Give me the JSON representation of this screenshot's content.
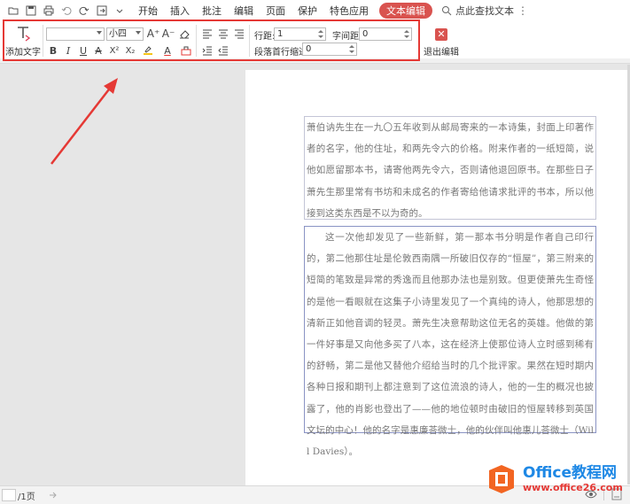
{
  "menu": {
    "items": [
      "开始",
      "插入",
      "批注",
      "编辑",
      "页面",
      "保护",
      "特色应用"
    ],
    "active": "文本编辑",
    "search": "点此查找文本"
  },
  "ribbon": {
    "add_text": "添加文字",
    "font_name": "",
    "font_size": "小四",
    "line_spacing_label": "行距:",
    "line_spacing_value": "1",
    "char_spacing_label": "字间距:",
    "char_spacing_value": "0",
    "indent_label": "段落首行缩进:",
    "indent_value": "0",
    "exit_edit": "退出编辑",
    "bold": "B",
    "italic": "I",
    "underline": "U",
    "strike": "A",
    "superscript": "X²",
    "subscript": "X₂",
    "grow_font": "A⁺",
    "shrink_font": "A⁻",
    "font_color": "A"
  },
  "document": {
    "paragraph1": "萧伯讷先生在一九〇五年收到从邮局寄来的一本诗集，封面上印著作者的名字，他的住址，和两先令六的价格。附来作者的一纸短简，说他如愿留那本书，请寄他两先令六，否则请他退回原书。在那些日子萧先生那里常有书坊和未成名的作者寄给他请求批评的书本，所以他接到这类东西是不以为奇的。",
    "paragraph2": "这一次他却发见了一些新鲜，第一那本书分明是作者自己印行的，第二他那住址是伦敦西南隅一所破旧仅存的“恒屋”，第三附来的短简的笔致是异常的秀逸而且他那办法也是别致。但更使萧先生奇怪的是他一看眼就在这集子小诗里发见了一个真纯的诗人，他那思想的清新正如他音调的轻灵。萧先生决意帮助这位无名的英雄。他做的第一件好事是又向他多买了八本，这在经济上使那位诗人立时感到稀有的舒畅，第二是他又替他介绍给当时的几个批评家。果然在短时期内各种日报和期刊上都注意到了这位流浪的诗人，他的一生的概况也披露了，他的肖影也登出了——他的地位顿时由破旧的恒屋转移到英国文坛的中心！他的名字是惠廉荅微士，他的伙伴叫他惠儿荅微士（Will Davies）。"
  },
  "status": {
    "page_count": "/1页"
  },
  "watermark": {
    "line1": "Office教程网",
    "line2": "www.office26.com"
  },
  "colors": {
    "accent": "#d9534f",
    "highlight_box": "#e53935",
    "logo_blue": "#1e88e5",
    "logo_orange": "#f26522"
  }
}
